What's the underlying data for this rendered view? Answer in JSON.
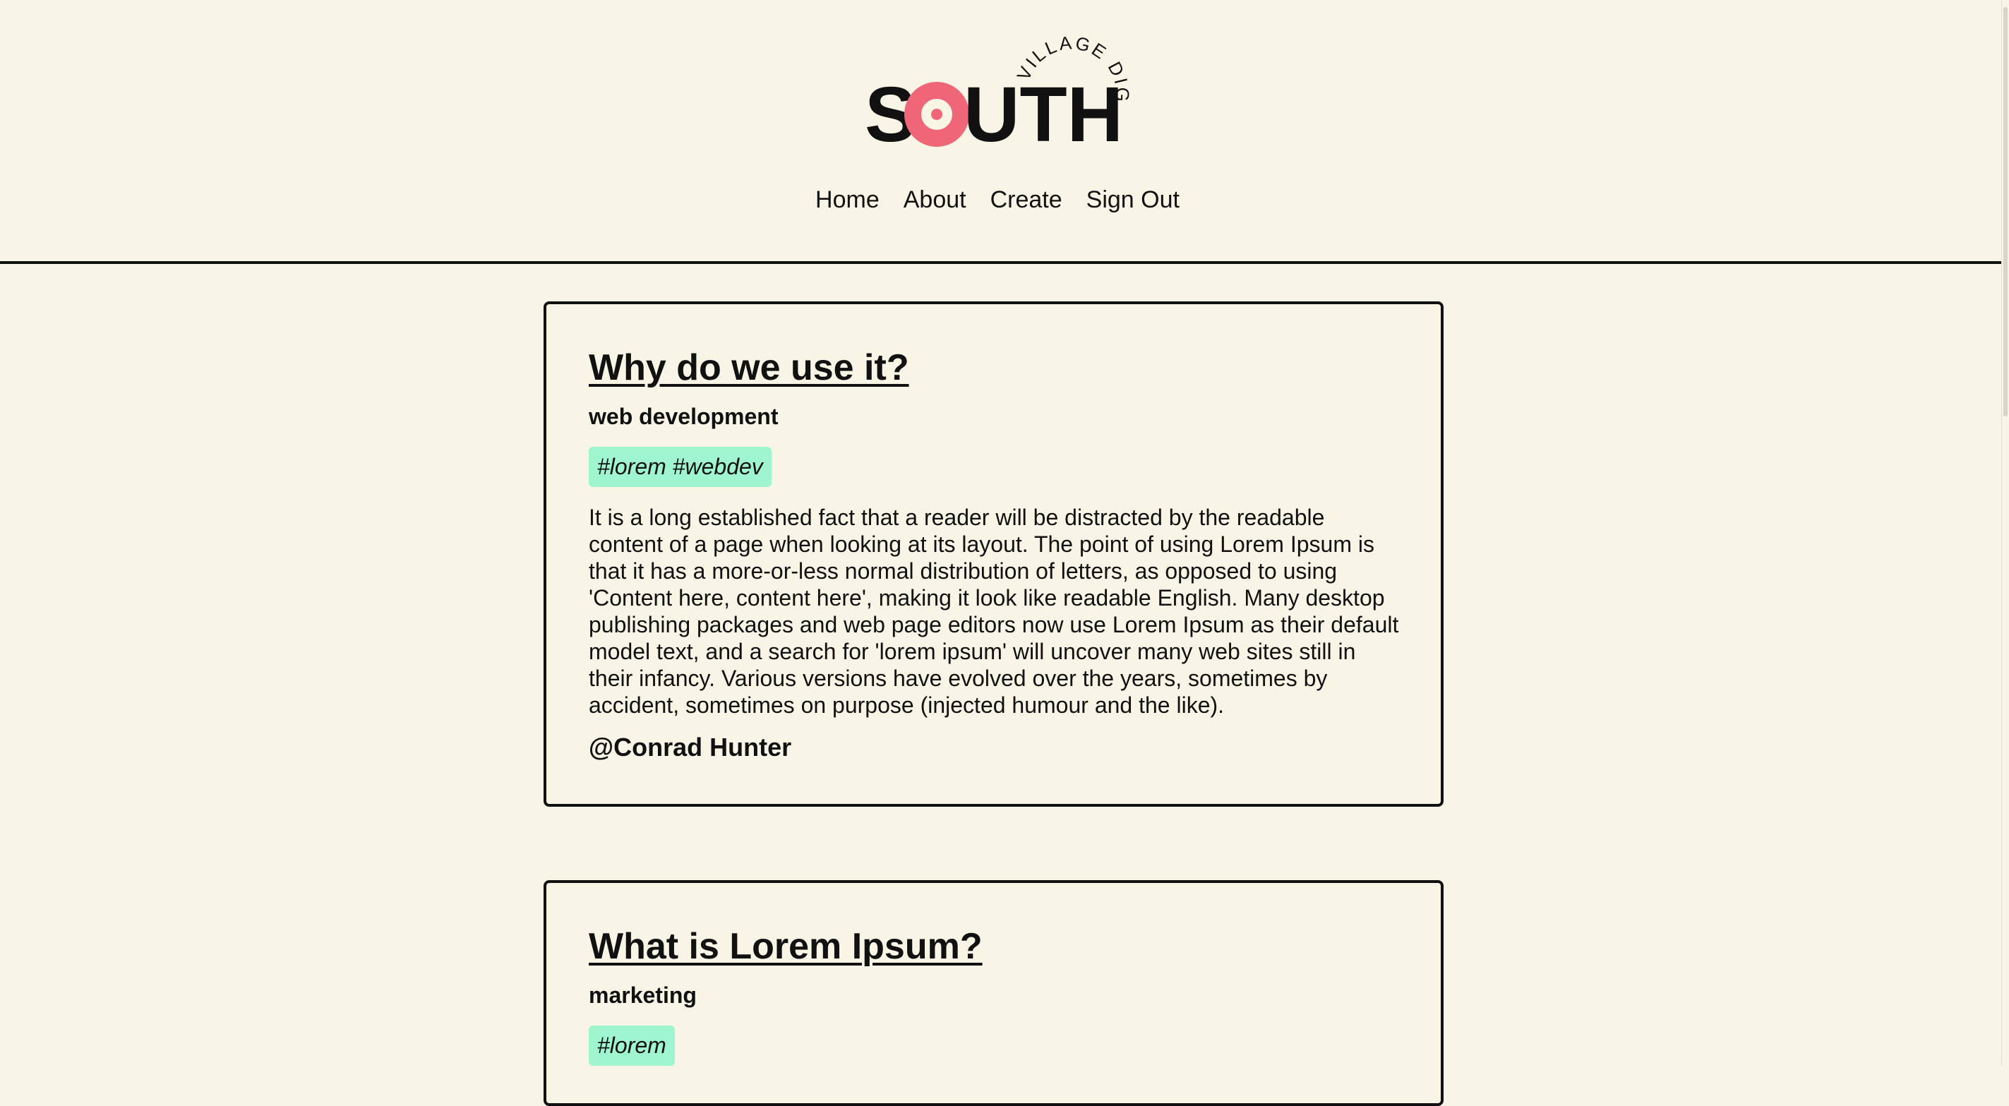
{
  "brand": {
    "wordmark": "SOUTH",
    "arc_text": "VILLAGE DIGITAL",
    "accent_color": "#ee6677"
  },
  "nav": {
    "items": [
      {
        "label": "Home"
      },
      {
        "label": "About"
      },
      {
        "label": "Create"
      },
      {
        "label": "Sign Out"
      }
    ]
  },
  "posts": [
    {
      "title": "Why do we use it?",
      "category": "web development",
      "tags": "#lorem #webdev",
      "body": "It is a long established fact that a reader will be distracted by the readable content of a page when looking at its layout. The point of using Lorem Ipsum is that it has a more-or-less normal distribution of letters, as opposed to using 'Content here, content here', making it look like readable English. Many desktop publishing packages and web page editors now use Lorem Ipsum as their default model text, and a search for 'lorem ipsum' will uncover many web sites still in their infancy. Various versions have evolved over the years, sometimes by accident, sometimes on purpose (injected humour and the like).",
      "author": "@Conrad Hunter"
    },
    {
      "title": "What is Lorem Ipsum?",
      "category": "marketing",
      "tags": "#lorem"
    }
  ],
  "colors": {
    "background": "#f8f5e6",
    "tag_background": "#9ef5cf",
    "text": "#111111"
  }
}
